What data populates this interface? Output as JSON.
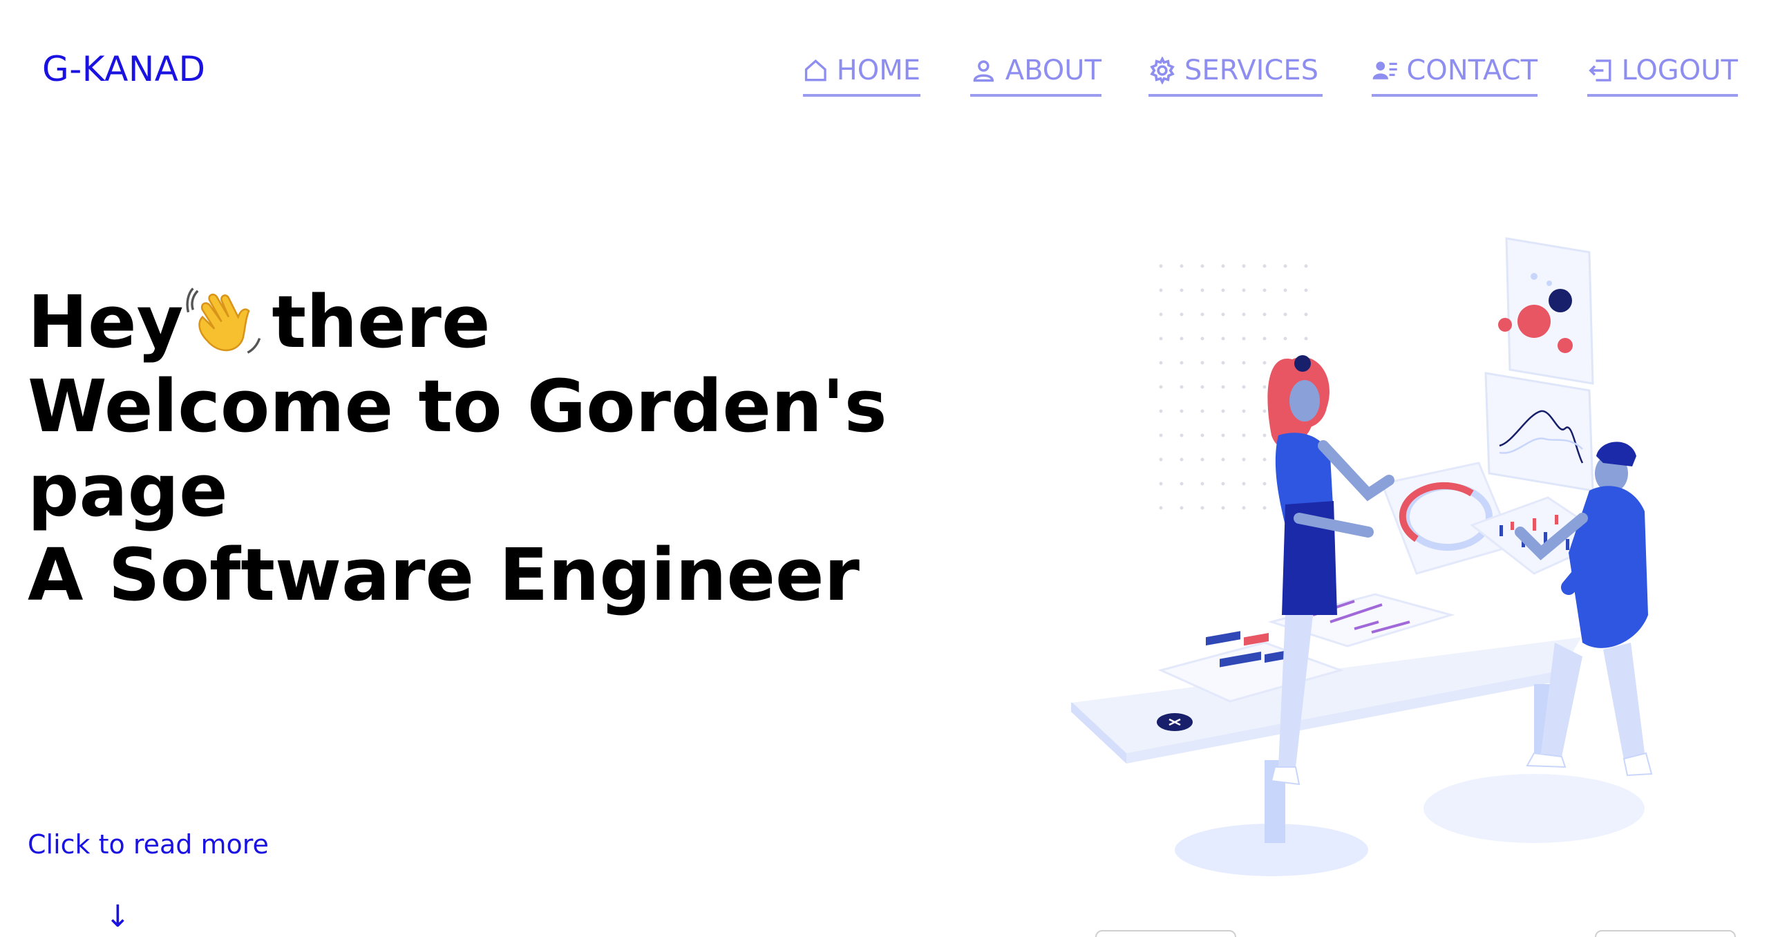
{
  "brand": {
    "logo": "G-KANAD"
  },
  "nav": {
    "items": [
      {
        "label": "HOME",
        "icon": "home-icon"
      },
      {
        "label": "ABOUT",
        "icon": "user-icon"
      },
      {
        "label": "SERVICES",
        "icon": "gear-icon"
      },
      {
        "label": "CONTACT",
        "icon": "contact-card-icon"
      },
      {
        "label": "LOGOUT",
        "icon": "logout-icon"
      }
    ],
    "color": "#8e8ef0"
  },
  "hero": {
    "line1_before": "Hey",
    "line1_after": "there",
    "line2": "Welcome to Gorden's",
    "line3": "page",
    "line4": "A Software Engineer",
    "emoji": "waving-hand-icon"
  },
  "cta": {
    "label": "Click to read more",
    "arrow": "↓"
  },
  "colors": {
    "accent": "#1a12e0",
    "text": "#000000",
    "nav": "#8e8ef0"
  }
}
